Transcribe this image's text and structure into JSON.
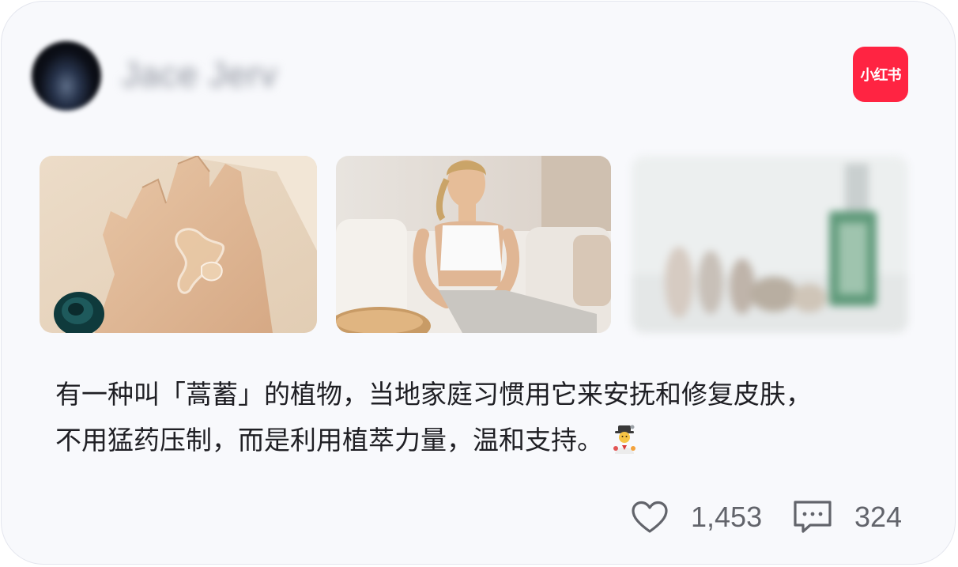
{
  "post": {
    "author": {
      "name": "Jace Jerv",
      "avatar_icon": "avatar-icon"
    },
    "brand": {
      "label": "小红书",
      "color": "#ff2442"
    },
    "images": [
      {
        "subject": "hand-with-gel-photo"
      },
      {
        "subject": "woman-on-sofa-photo"
      },
      {
        "subject": "blurred-products-photo"
      }
    ],
    "text_lines": [
      "有一种叫「蒿蓄」的植物，当地家庭习惯用它来安抚和修复皮肤，",
      "不用猛药压制，而是利用植萃力量，温和支持。"
    ],
    "emoji": "farmer-emoji",
    "stats": {
      "likes": "1,453",
      "comments": "324",
      "like_icon": "heart-icon",
      "comment_icon": "comment-icon"
    }
  }
}
